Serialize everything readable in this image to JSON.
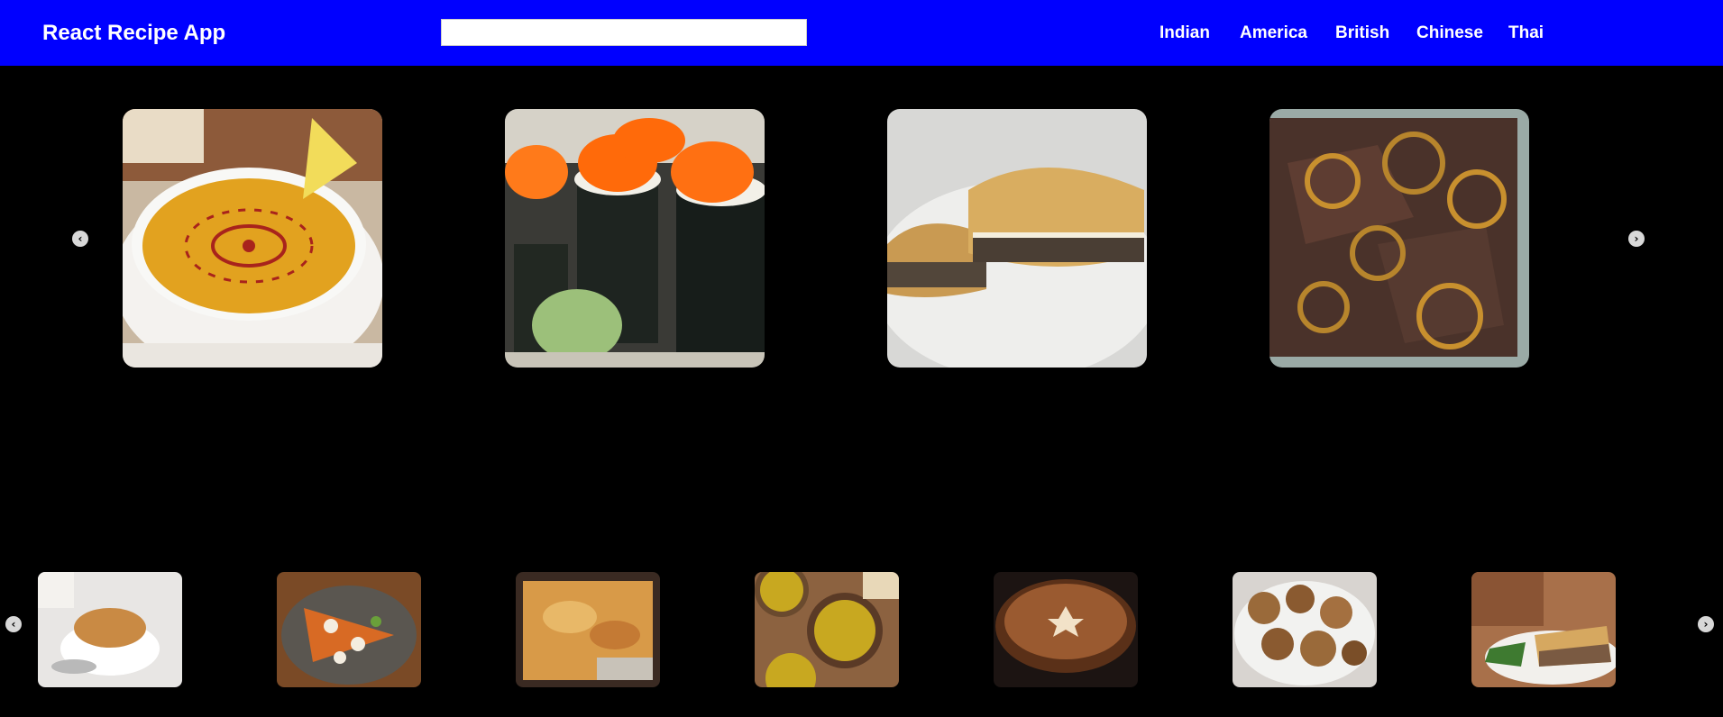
{
  "header": {
    "title": "React Recipe App",
    "search_value": "",
    "cuisines": [
      "Indian",
      "America",
      "British",
      "Chinese",
      "Thai"
    ],
    "accent_color": "#0000ff"
  },
  "top_carousel": {
    "prev_icon": "chevron-left-icon",
    "next_icon": "chevron-right-icon",
    "items": [
      {
        "name": "lentil-soup-image"
      },
      {
        "name": "sushi-image"
      },
      {
        "name": "meat-pie-image"
      },
      {
        "name": "liver-and-onions-image"
      }
    ]
  },
  "bottom_carousel": {
    "prev_icon": "chevron-left-icon",
    "next_icon": "chevron-right-icon",
    "items": [
      {
        "name": "pudding-bowl-image"
      },
      {
        "name": "poutine-image"
      },
      {
        "name": "baked-casserole-image"
      },
      {
        "name": "pea-soup-image"
      },
      {
        "name": "chocolate-pie-image"
      },
      {
        "name": "fritters-image"
      },
      {
        "name": "tourtiere-image"
      }
    ]
  }
}
